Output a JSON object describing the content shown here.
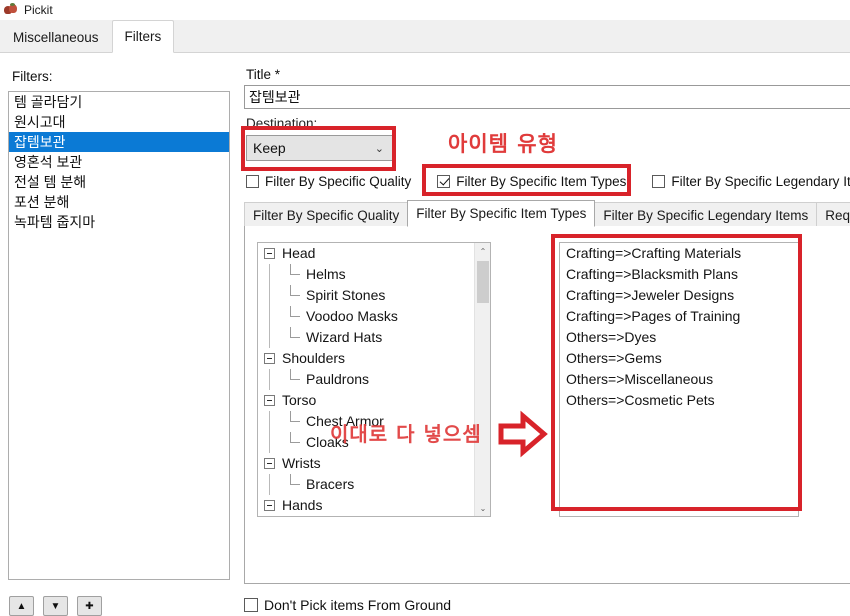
{
  "window": {
    "title": "Pickit",
    "icon": "pickit-app-icon"
  },
  "outer_tabs": [
    {
      "label": "Miscellaneous",
      "active": false
    },
    {
      "label": "Filters",
      "active": true
    }
  ],
  "left_panel": {
    "label": "Filters:",
    "items": [
      {
        "label": "템 골라담기",
        "selected": false
      },
      {
        "label": "원시고대",
        "selected": false
      },
      {
        "label": "잡템보관",
        "selected": true
      },
      {
        "label": "영혼석 보관",
        "selected": false
      },
      {
        "label": "전설 템 분해",
        "selected": false
      },
      {
        "label": "포션 분해",
        "selected": false
      },
      {
        "label": "녹파템 줍지마",
        "selected": false
      }
    ],
    "buttons": [
      {
        "name": "move-up-button",
        "glyph": "▲"
      },
      {
        "name": "move-down-button",
        "glyph": "▼"
      },
      {
        "name": "add-filter-button",
        "glyph": "✚"
      }
    ]
  },
  "form": {
    "title_label": "Title *",
    "title_value": "잡템보관",
    "destination_label": "Destination:",
    "destination_value": "Keep",
    "destination_chevron": "⌄"
  },
  "checkboxes": [
    {
      "label": "Filter By Specific Quality",
      "checked": false
    },
    {
      "label": "Filter By Specific Item Types",
      "checked": true
    },
    {
      "label": "Filter By Specific Legendary Ite",
      "checked": false
    }
  ],
  "inner_tabs": [
    {
      "label": "Filter By Specific Quality",
      "active": false
    },
    {
      "label": "Filter By Specific Item Types",
      "active": true
    },
    {
      "label": "Filter By Specific Legendary Items",
      "active": false
    },
    {
      "label": "Requ",
      "active": false
    }
  ],
  "tree": {
    "nodes": [
      {
        "label": "Head",
        "level": 0,
        "expanded": true
      },
      {
        "label": "Helms",
        "level": 1,
        "last": false
      },
      {
        "label": "Spirit Stones",
        "level": 1,
        "last": false
      },
      {
        "label": "Voodoo Masks",
        "level": 1,
        "last": false
      },
      {
        "label": "Wizard Hats",
        "level": 1,
        "last": true
      },
      {
        "label": "Shoulders",
        "level": 0,
        "expanded": true
      },
      {
        "label": "Pauldrons",
        "level": 1,
        "last": true
      },
      {
        "label": "Torso",
        "level": 0,
        "expanded": true
      },
      {
        "label": "Chest Armor",
        "level": 1,
        "last": false
      },
      {
        "label": "Cloaks",
        "level": 1,
        "last": true
      },
      {
        "label": "Wrists",
        "level": 0,
        "expanded": true
      },
      {
        "label": "Bracers",
        "level": 1,
        "last": true
      },
      {
        "label": "Hands",
        "level": 0,
        "expanded": true
      }
    ],
    "scroll_up_glyph": "⌃",
    "scroll_down_glyph": "⌄"
  },
  "transfer_button": {
    "name": "transfer-equals-button",
    "glyph": "="
  },
  "selected_list": {
    "items": [
      "Crafting=>Crafting Materials",
      "Crafting=>Blacksmith Plans",
      "Crafting=>Jeweler Designs",
      "Crafting=>Pages of Training",
      "Others=>Dyes",
      "Others=>Gems",
      "Others=>Miscellaneous",
      "Others=>Cosmetic Pets"
    ]
  },
  "bottom": {
    "dont_pick_label": "Don't Pick items From Ground",
    "dont_pick_checked": false
  },
  "annotations": {
    "item_type_text": "아이템 유형",
    "put_all_text": "이대로 다 넣으셈",
    "red_color": "#d8232a",
    "red_text_color": "#e03b3b"
  }
}
